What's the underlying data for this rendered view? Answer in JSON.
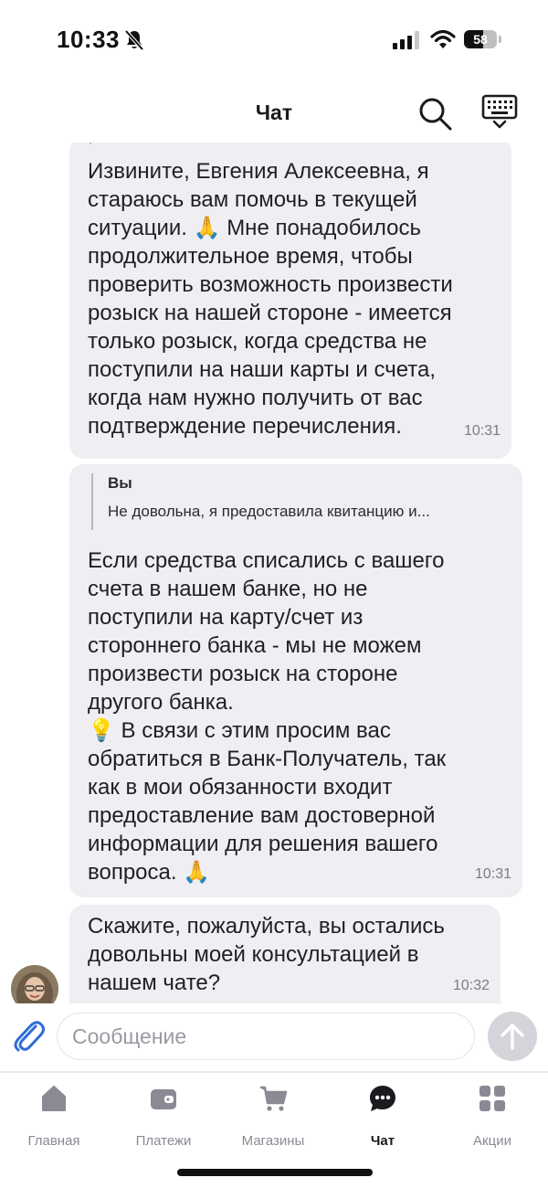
{
  "status_bar": {
    "time": "10:33",
    "battery": "58"
  },
  "header": {
    "title": "Чат"
  },
  "messages": [
    {
      "text": "Извините, Евгения Алексеевна, я\nстараюсь вам помочь в текущей\nситуации. 🙏 Мне понадобилось\nпродолжительное время, чтобы\nпроверить возможность произвести\nрозыск на нашей стороне - имеется\nтолько розыск, когда средства не\nпоступили на наши карты и счета,\nкогда нам нужно получить от вас\nподтверждение перечисления.",
      "time": "10:31"
    },
    {
      "quote_author": "Вы",
      "quote_text": "Не довольна, я предоставила квитанцию и...",
      "text": "Если средства списались с вашего\nсчета в нашем банке, но не\nпоступили на карту/счет из\nстороннего банка - мы не можем\nпроизвести розыск на стороне\nдругого банка.\n💡 В связи с этим просим вас\nобратиться в Банк-Получатель, так\nкак в мои обязанности входит\nпредоставление вам достоверной\nинформации для решения вашего\nвопроса. 🙏",
      "time": "10:31"
    },
    {
      "text": "Скажите, пожалуйста, вы остались\nдовольны моей консультацией в\nнашем чате?",
      "time": "10:32"
    }
  ],
  "composer": {
    "placeholder": "Сообщение"
  },
  "tabs": [
    {
      "label": "Главная",
      "icon": "home-icon"
    },
    {
      "label": "Платежи",
      "icon": "wallet-icon"
    },
    {
      "label": "Магазины",
      "icon": "cart-icon"
    },
    {
      "label": "Чат",
      "icon": "chat-icon",
      "active": true
    },
    {
      "label": "Акции",
      "icon": "grid-icon"
    }
  ],
  "colors": {
    "bubble": "#eeeef3",
    "active_tab": "#1b1b1f",
    "inactive_tab": "#8a8a94"
  }
}
